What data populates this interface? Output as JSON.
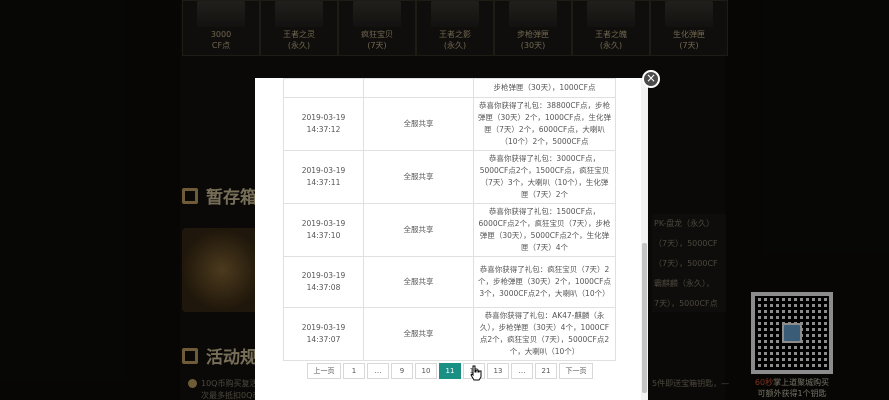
{
  "rewards": [
    {
      "name": "3000",
      "duration": "CF点"
    },
    {
      "name": "王者之灵",
      "duration": "(永久)"
    },
    {
      "name": "疯狂宝贝",
      "duration": "(7天)"
    },
    {
      "name": "王者之影",
      "duration": "(永久)"
    },
    {
      "name": "步枪弹匣",
      "duration": "(30天)"
    },
    {
      "name": "王者之魄",
      "duration": "(永久)"
    },
    {
      "name": "生化弹匣",
      "duration": "(7天)"
    }
  ],
  "sections": {
    "storage_title": "暂存箱",
    "activity_title": "活动规"
  },
  "right_list": [
    "PK-盘龙（永久）",
    "（7天），5000CF",
    "（7天），5000CF",
    "霸麒麟（永久），",
    "7天），5000CF点"
  ],
  "notes": {
    "line1": "10Q币购买复活",
    "line2": "次最多抵扣0Q币",
    "right1": "5件即送宝箱钥匙，",
    "right2": "—"
  },
  "qr": {
    "caption_highlight": "60秒",
    "caption_line1": "掌上道聚城购买",
    "caption_line2": "可额外获得1个钥匙"
  },
  "modal": {
    "close_label": "×",
    "partial_row": {
      "date": "",
      "time": "",
      "server": "",
      "content": "步枪弹匣（30天），1000CF点"
    },
    "rows": [
      {
        "date": "2019-03-19",
        "time": "14:37:12",
        "server": "全服共享",
        "content": "恭喜你获得了礼包：38800CF点，步枪弹匣（30天）2个，1000CF点，生化弹匣（7天）2个，6000CF点，大喇叭（10个）2个，5000CF点"
      },
      {
        "date": "2019-03-19",
        "time": "14:37:11",
        "server": "全服共享",
        "content": "恭喜你获得了礼包：3000CF点，5000CF点2个，1500CF点，疯狂宝贝（7天）3个，大喇叭（10个），生化弹匣（7天）2个"
      },
      {
        "date": "2019-03-19",
        "time": "14:37:10",
        "server": "全服共享",
        "content": "恭喜你获得了礼包：1500CF点，6000CF点2个，疯狂宝贝（7天），步枪弹匣（30天），5000CF点2个，生化弹匣（7天）4个"
      },
      {
        "date": "2019-03-19",
        "time": "14:37:08",
        "server": "全服共享",
        "content": "恭喜你获得了礼包：疯狂宝贝（7天）2个，步枪弹匣（30天）2个，1000CF点3个，3000CF点2个，大喇叭（10个）"
      },
      {
        "date": "2019-03-19",
        "time": "14:37:07",
        "server": "全服共享",
        "content": "恭喜你获得了礼包：AK47-麒麟（永久），步枪弹匣（30天）4个，1000CF点2个，疯狂宝贝（7天），5000CF点2个，大喇叭（10个）"
      }
    ],
    "pagination": [
      "上一页",
      "1",
      "…",
      "9",
      "10",
      "11",
      "12",
      "13",
      "…",
      "21",
      "下一页"
    ],
    "current_page": "11"
  }
}
